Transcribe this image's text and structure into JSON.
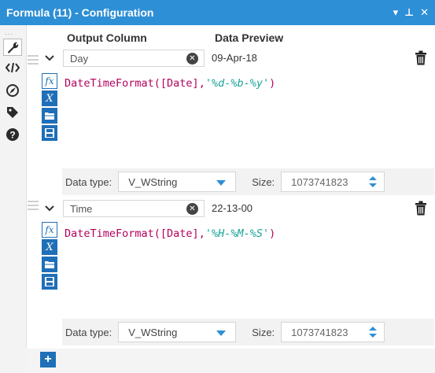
{
  "window": {
    "title": "Formula (11) - Configuration",
    "controls": [
      "▾",
      "⊥",
      "✕"
    ]
  },
  "sidebar": {
    "overflow": "...",
    "icons": [
      "wrench-icon",
      "code-icon",
      "compass-icon",
      "tag-icon",
      "help-icon"
    ]
  },
  "columns": {
    "output": "Output Column",
    "preview": "Data Preview"
  },
  "formulas": [
    {
      "name": "Day",
      "preview": "09-Apr-18",
      "func": "DateTimeFormat(",
      "field": "[Date]",
      "comma": ",",
      "format": "'%d-%b-%y'",
      "close": ")",
      "type_label": "Data type:",
      "type": "V_WString",
      "size_label": "Size:",
      "size": "1073741823"
    },
    {
      "name": "Time",
      "preview": "22-13-00",
      "func": "DateTimeFormat(",
      "field": "[Date]",
      "comma": ",",
      "format": "'%H-%M-%S'",
      "close": ")",
      "type_label": "Data type:",
      "type": "V_WString",
      "size_label": "Size:",
      "size": "1073741823"
    }
  ],
  "toolbar_icons": [
    "fx",
    "X"
  ],
  "add_button": "+",
  "colors": {
    "titlebar": "#2d8fd5",
    "tool_button": "#1f6fb8",
    "function_text": "#b5005b",
    "string_text": "#1aa39a"
  }
}
